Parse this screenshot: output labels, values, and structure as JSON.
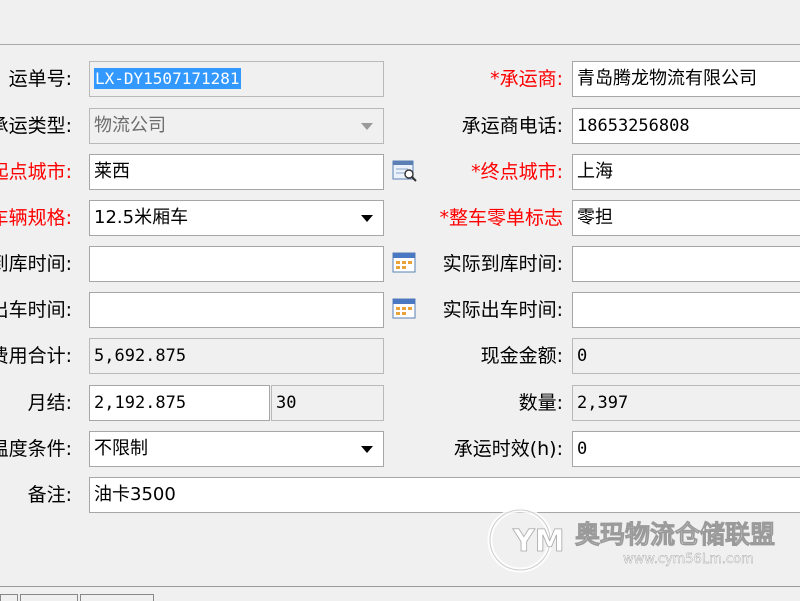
{
  "form": {
    "waybill_no": {
      "label": "运单号:",
      "value": "LX-DY1507171281"
    },
    "carrier": {
      "label": "*承运商:",
      "value": "青岛腾龙物流有限公司"
    },
    "carrier_type": {
      "label": "承运类型:",
      "value": "物流公司"
    },
    "carrier_phone": {
      "label": "承运商电话:",
      "value": "18653256808"
    },
    "origin_city": {
      "label": "起点城市:",
      "value": "莱西"
    },
    "dest_city": {
      "label": "*终点城市:",
      "value": "上海"
    },
    "vehicle_spec": {
      "label": "车辆规格:",
      "value": "12.5米厢车"
    },
    "load_type": {
      "label": "*整车零单标志",
      "value": "零担"
    },
    "arrive_time": {
      "label": "到库时间:",
      "value": ""
    },
    "actual_arrive_time": {
      "label": "实际到库时间:",
      "value": ""
    },
    "depart_time": {
      "label": "出车时间:",
      "value": ""
    },
    "actual_depart_time": {
      "label": "实际出车时间:",
      "value": ""
    },
    "total_cost": {
      "label": "费用合计:",
      "value": "5,692.875"
    },
    "cash_amount": {
      "label": "现金金额:",
      "value": "0"
    },
    "monthly": {
      "label": "月结:",
      "value": "2,192.875",
      "days": "30"
    },
    "quantity": {
      "label": "数量:",
      "value": "2,397"
    },
    "temperature": {
      "label": "温度条件:",
      "value": "不限制"
    },
    "transit_time": {
      "label": "承运时效(h):",
      "value": "0"
    },
    "remarks": {
      "label": "备注:",
      "value": "油卡3500"
    }
  },
  "watermark": {
    "brand": "YM",
    "text": "奥玛物流仓储联盟",
    "url": "www.cym56Lm.com"
  },
  "colors": {
    "required": "#ff0000",
    "selection": "#3399ff",
    "background": "#f0f0f0",
    "border": "#a6a6a6"
  },
  "icons": {
    "lookup": "search-lookup-icon",
    "calendar": "calendar-icon",
    "dropdown": "chevron-down-icon"
  }
}
